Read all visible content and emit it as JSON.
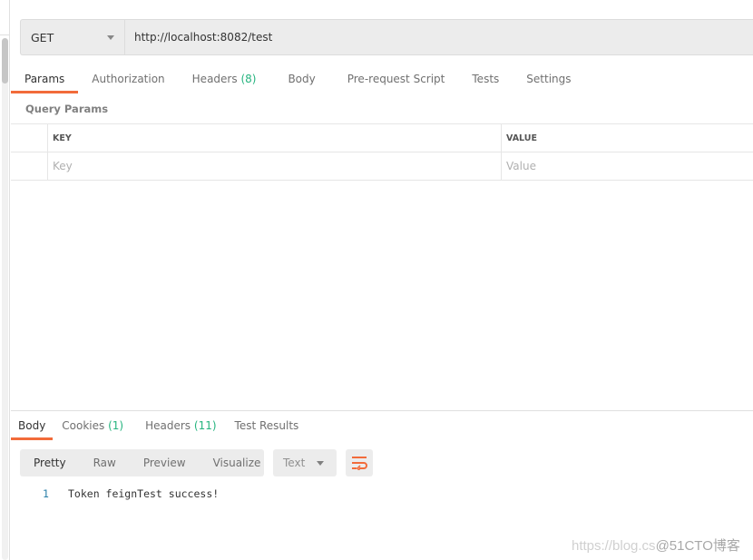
{
  "request": {
    "method": "GET",
    "url": "http://localhost:8082/test"
  },
  "request_tabs": [
    {
      "label": "Params",
      "count": ""
    },
    {
      "label": "Authorization",
      "count": ""
    },
    {
      "label": "Headers",
      "count": "(8)"
    },
    {
      "label": "Body",
      "count": ""
    },
    {
      "label": "Pre-request Script",
      "count": ""
    },
    {
      "label": "Tests",
      "count": ""
    },
    {
      "label": "Settings",
      "count": ""
    }
  ],
  "query_params": {
    "title": "Query Params",
    "headers": {
      "key": "KEY",
      "value": "VALUE"
    },
    "placeholders": {
      "key": "Key",
      "value": "Value"
    }
  },
  "response_tabs": [
    {
      "label": "Body",
      "count": ""
    },
    {
      "label": "Cookies",
      "count": "(1)"
    },
    {
      "label": "Headers",
      "count": "(11)"
    },
    {
      "label": "Test Results",
      "count": ""
    }
  ],
  "view_modes": [
    "Pretty",
    "Raw",
    "Preview",
    "Visualize"
  ],
  "format": "Text",
  "response_body": [
    {
      "line": "1",
      "text": "Token feignTest success!"
    }
  ],
  "watermark": {
    "url": "https://blog.cs",
    "brand": "@51CTO博客"
  },
  "colors": {
    "accent": "#f26b3a",
    "count": "#26b47f"
  }
}
